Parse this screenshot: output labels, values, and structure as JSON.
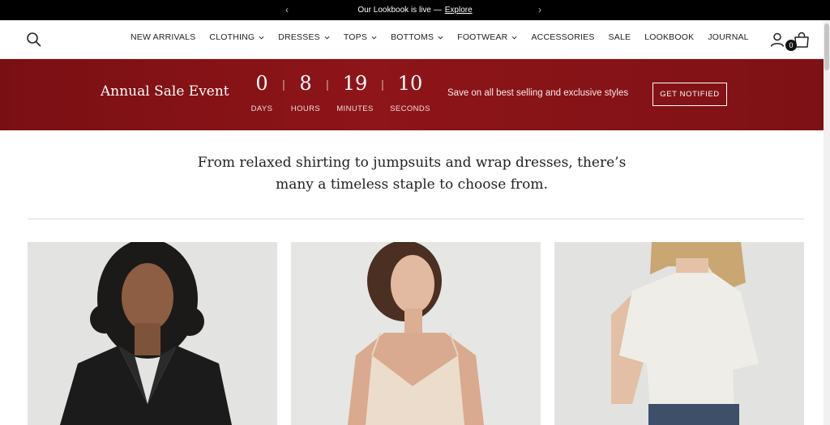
{
  "announcement": {
    "text": "Our Lookbook is live —",
    "link": "Explore"
  },
  "header": {
    "nav": [
      {
        "label": "NEW ARRIVALS",
        "dropdown": false
      },
      {
        "label": "CLOTHING",
        "dropdown": true
      },
      {
        "label": "DRESSES",
        "dropdown": true
      },
      {
        "label": "TOPS",
        "dropdown": true
      },
      {
        "label": "BOTTOMS",
        "dropdown": true
      },
      {
        "label": "FOOTWEAR",
        "dropdown": true
      },
      {
        "label": "ACCESSORIES",
        "dropdown": false
      },
      {
        "label": "SALE",
        "dropdown": false
      },
      {
        "label": "LOOKBOOK",
        "dropdown": false
      },
      {
        "label": "JOURNAL",
        "dropdown": false
      }
    ],
    "cart_count": "0",
    "icons": [
      "search-icon",
      "account-icon",
      "cart-icon"
    ]
  },
  "sale_banner": {
    "title": "Annual Sale Event",
    "countdown": [
      {
        "value": "0",
        "label": "DAYS"
      },
      {
        "value": "8",
        "label": "HOURS"
      },
      {
        "value": "19",
        "label": "MINUTES"
      },
      {
        "value": "10",
        "label": "SECONDS"
      }
    ],
    "description": "Save on all best selling and exclusive styles",
    "button": "GET NOTIFIED",
    "color": "#861317"
  },
  "intro": {
    "line1": "From relaxed shirting to jumpsuits and wrap dresses, there’s",
    "line2": "many a timeless staple to choose from."
  }
}
